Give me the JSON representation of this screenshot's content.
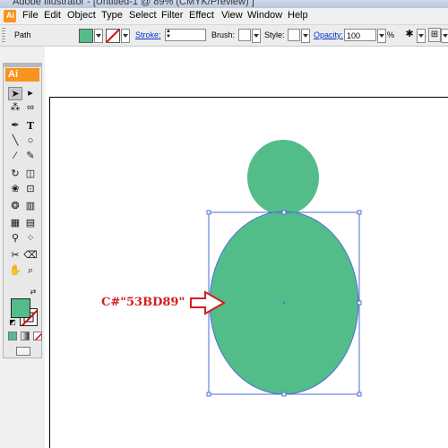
{
  "window": {
    "title": "Adobe Illustrator - [Untitled-1 @ 89% (CMYK/Preview) ]"
  },
  "menu": [
    "File",
    "Edit",
    "Object",
    "Type",
    "Select",
    "Filter",
    "Effect",
    "View",
    "Window",
    "Help"
  ],
  "control_bar": {
    "selection_label": "Path",
    "stroke_label": "Stroke:",
    "brush_label": "Brush:",
    "style_label": "Style:",
    "opacity_label": "Opacity:",
    "opacity_value": "100",
    "percent": "%"
  },
  "tools_panel": {
    "logo": "Ai"
  },
  "colors": {
    "fill": "#53BD89",
    "selection": "#4a6fd8",
    "annotation": "#d21f1f",
    "app_accent": "#f7941d"
  },
  "icons": [
    "selection-arrow-icon",
    "direct-selection-icon",
    "magic-wand-icon",
    "lasso-icon",
    "pen-icon",
    "type-icon",
    "line-icon",
    "ellipse-icon",
    "paintbrush-icon",
    "pencil-icon",
    "rotate-icon",
    "scale-icon",
    "warp-icon",
    "free-transform-icon",
    "symbol-sprayer-icon",
    "graph-icon",
    "mesh-icon",
    "gradient-icon",
    "eyedropper-icon",
    "blend-icon",
    "slice-icon",
    "eraser-icon",
    "hand-icon",
    "zoom-icon"
  ],
  "annotation": {
    "text": "C#\"53BD89\""
  }
}
